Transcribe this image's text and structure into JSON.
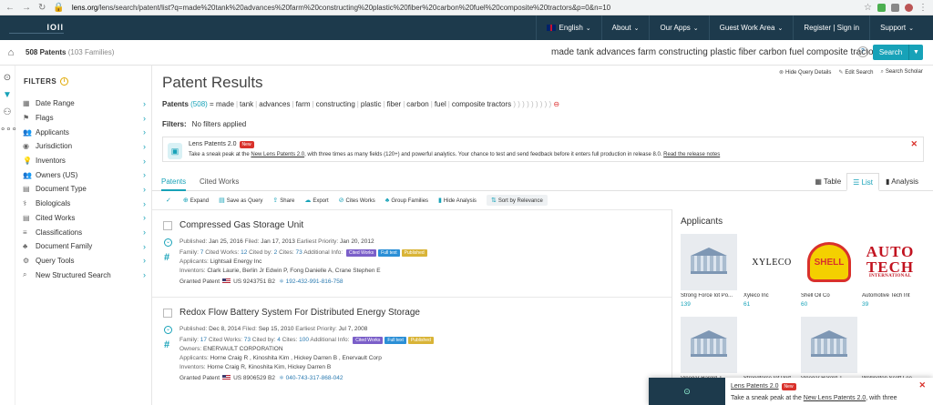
{
  "browser": {
    "url_host": "lens.org",
    "url_path": "/lens/search/patent/list?q=made%20tank%20advances%20farm%20constructing%20plastic%20fiber%20carbon%20fuel%20composite%20tractors&p=0&n=10"
  },
  "appbar": {
    "logo": "lOll",
    "menu": [
      {
        "label": "English",
        "caret": "⌄"
      },
      {
        "label": "About",
        "caret": "⌄"
      },
      {
        "label": "Our Apps",
        "caret": "⌄"
      },
      {
        "label": "Guest Work Area",
        "caret": "⌄"
      },
      {
        "label": "Register | Sign in",
        "caret": ""
      },
      {
        "label": "Support",
        "caret": "⌄"
      }
    ]
  },
  "subbar": {
    "count": "508 Patents",
    "families": "(103 Families)",
    "query": "made tank advances farm constructing plastic fiber carbon fuel composite tractors",
    "help": "?",
    "search_label": "Search"
  },
  "filters": {
    "heading": "FILTERS",
    "items": [
      {
        "icon": "▦",
        "label": "Date Range"
      },
      {
        "icon": "⚑",
        "label": "Flags"
      },
      {
        "icon": "👥",
        "label": "Applicants"
      },
      {
        "icon": "◉",
        "label": "Jurisdiction"
      },
      {
        "icon": "💡",
        "label": "Inventors"
      },
      {
        "icon": "👥",
        "label": "Owners (US)"
      },
      {
        "icon": "▤",
        "label": "Document Type"
      },
      {
        "icon": "⚕",
        "label": "Biologicals"
      },
      {
        "icon": "▤",
        "label": "Cited Works"
      },
      {
        "icon": "≡",
        "label": "Classifications"
      },
      {
        "icon": "♣",
        "label": "Document Family"
      },
      {
        "icon": "⚙",
        "label": "Query Tools"
      },
      {
        "icon": "⌕",
        "label": "New Structured Search"
      }
    ]
  },
  "main": {
    "title": "Patent Results",
    "options": [
      "Hide Query Details",
      "Edit Search",
      "Search Scholar"
    ],
    "query_line": {
      "label": "Patents",
      "count": "(508)",
      "terms": [
        "made",
        "tank",
        "advances",
        "farm",
        "constructing",
        "plastic",
        "fiber",
        "carbon",
        "fuel",
        "composite tractors"
      ],
      "parens": ") ) ) ) ) ) ) ) )",
      "clear": "⊖"
    },
    "filters_line": {
      "label": "Filters:",
      "value": "No filters applied"
    },
    "banner": {
      "title": "Lens Patents 2.0",
      "new": "New",
      "text_before": "Take a sneak peak at the ",
      "link": "New Lens Patents 2.0",
      "text_after": ", with three times as many fields (120+) and powerful analytics. Your chance to test and send feedback before it enters full production in release 8.0. ",
      "link2": "Read the release notes"
    },
    "tabs": [
      "Patents",
      "Cited Works"
    ],
    "view_tabs": [
      "Table",
      "List",
      "Analysis"
    ],
    "toolbar": [
      "Expand",
      "Save as Query",
      "Share",
      "Export",
      "Cites Works",
      "Group Families",
      "Hide Analysis",
      "Sort by Relevance"
    ]
  },
  "results": [
    {
      "title": "Compressed Gas Storage Unit",
      "published": "Jan 25, 2016",
      "filed": "Jan 17, 2013",
      "priority": "Jan 20, 2012",
      "family": "7",
      "cited_works": "12",
      "cited_by": "2",
      "cites": "73",
      "owners": "",
      "applicants": "Lightsail Energy Inc",
      "inventors": "Clark Laurie, Berlin Jr Edwin P, Fong Danielle A, Crane Stephen E",
      "granted": "US 9243751 B2",
      "lens_id": "192-432-991-816-758"
    },
    {
      "title": "Redox Flow Battery System For Distributed Energy Storage",
      "published": "Dec 8, 2014",
      "filed": "Sep 15, 2010",
      "priority": "Jul 7, 2008",
      "family": "17",
      "cited_works": "73",
      "cited_by": "4",
      "cites": "100",
      "owners": "ENERVAULT CORPORATION",
      "applicants": "Horne Craig R , Kinoshita Kim , Hickey Darren B , Enervault Corp",
      "inventors": "Horne Craig R, Kinoshita Kim, Hickey Darren B",
      "granted": "US 8906529 B2",
      "lens_id": "040-743-317-868-042"
    }
  ],
  "labels": {
    "published": "Published:",
    "filed": "Filed:",
    "priority": "Earliest Priority:",
    "family": "Family:",
    "cited_works": "Cited Works:",
    "cited_by": "Cited by:",
    "cites": "Cites:",
    "additional": "Additional Info:",
    "owners": "Owners:",
    "applicants": "Applicants:",
    "inventors": "Inventors:",
    "granted": "Granted Patent",
    "badge_cited": "Cited Works",
    "badge_full": "Full text",
    "badge_pub": "Published"
  },
  "applicants": {
    "title": "Applicants",
    "cards": [
      {
        "name": "Strong Force Iot Po...",
        "count": "139",
        "logo": "building"
      },
      {
        "name": "Xyleco Inc",
        "count": "61",
        "logo": "XYLECO"
      },
      {
        "name": "Shell Oil Co",
        "count": "60",
        "logo": "SHELL"
      },
      {
        "name": "Automotive Tech Int",
        "count": "39",
        "logo": "AUTO TECH",
        "logo_sub": "INTERNATIONAL"
      },
      {
        "name": "Vinegar Harold J.",
        "count": "",
        "logo": "building"
      },
      {
        "name": "Strongforce Iot Port...",
        "count": "",
        "logo": "blank"
      },
      {
        "name": "Vinegar Harold J.",
        "count": "",
        "logo": "building"
      },
      {
        "name": "Wellington Scott Lee",
        "count": "",
        "logo": "blank"
      }
    ]
  },
  "toast": {
    "title": "Lens Patents 2.0",
    "new": "New",
    "text_before": "Take a sneak peak at the ",
    "link": "New Lens Patents 2.0",
    "text_after": ", with three"
  },
  "colors": {
    "accent": "#17a2b8",
    "header": "#1d3a4c",
    "danger": "#d9312b"
  }
}
